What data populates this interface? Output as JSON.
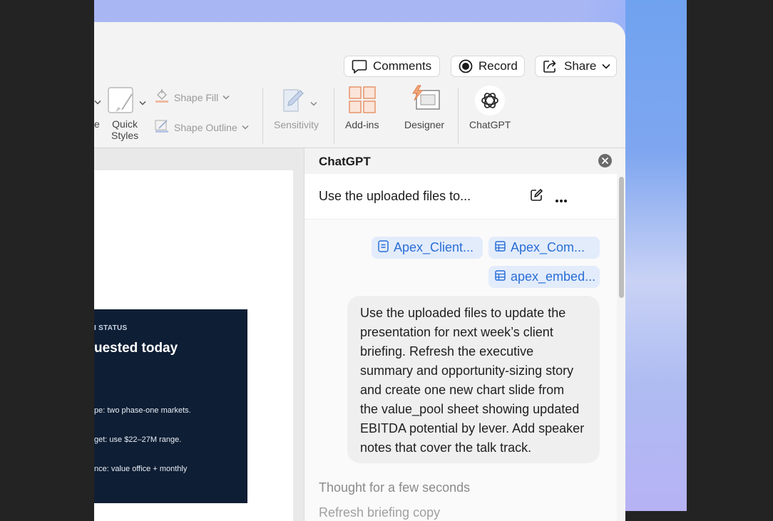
{
  "toolbar": {
    "comments_label": "Comments",
    "record_label": "Record",
    "share_label": "Share"
  },
  "ribbon": {
    "cut_label": "e",
    "quick_styles_label_1": "Quick",
    "quick_styles_label_2": "Styles",
    "shape_fill_label": "Shape Fill",
    "shape_outline_label": "Shape Outline",
    "sensitivity_label": "Sensitivity",
    "addins_label": "Add-ins",
    "designer_label": "Designer",
    "chatgpt_label": "ChatGPT"
  },
  "slide": {
    "eyebrow": "I STATUS",
    "headline": "uested today",
    "lines": [
      "pe: two phase-one markets.",
      "get: use $22–27M range.",
      "nce: value office + monthly"
    ]
  },
  "pane": {
    "title": "ChatGPT",
    "conversation_title": "Use the uploaded files to...",
    "attachments": [
      {
        "label": "Apex_Client...",
        "icon": "document-icon"
      },
      {
        "label": "Apex_Com...",
        "icon": "table-icon"
      },
      {
        "label": "apex_embed...",
        "icon": "table-icon"
      }
    ],
    "message_lines": [
      "Use the uploaded files to update the",
      "presentation for next week’s client",
      "briefing. Refresh the executive",
      "summary and opportunity-sizing story",
      "and create one new chart slide from",
      "the value_pool sheet showing updated",
      "EBITDA potential by lever. Add speaker",
      "notes that cover the talk track."
    ],
    "thought_label": "Thought for a few seconds",
    "cutoff_text": "Refresh briefing copy"
  },
  "colors": {
    "accent_blue": "#2a6fd6",
    "chip_bg": "#e3ecfb",
    "slide_navy": "#0e1e34",
    "addins_orange": "#e8946a"
  }
}
